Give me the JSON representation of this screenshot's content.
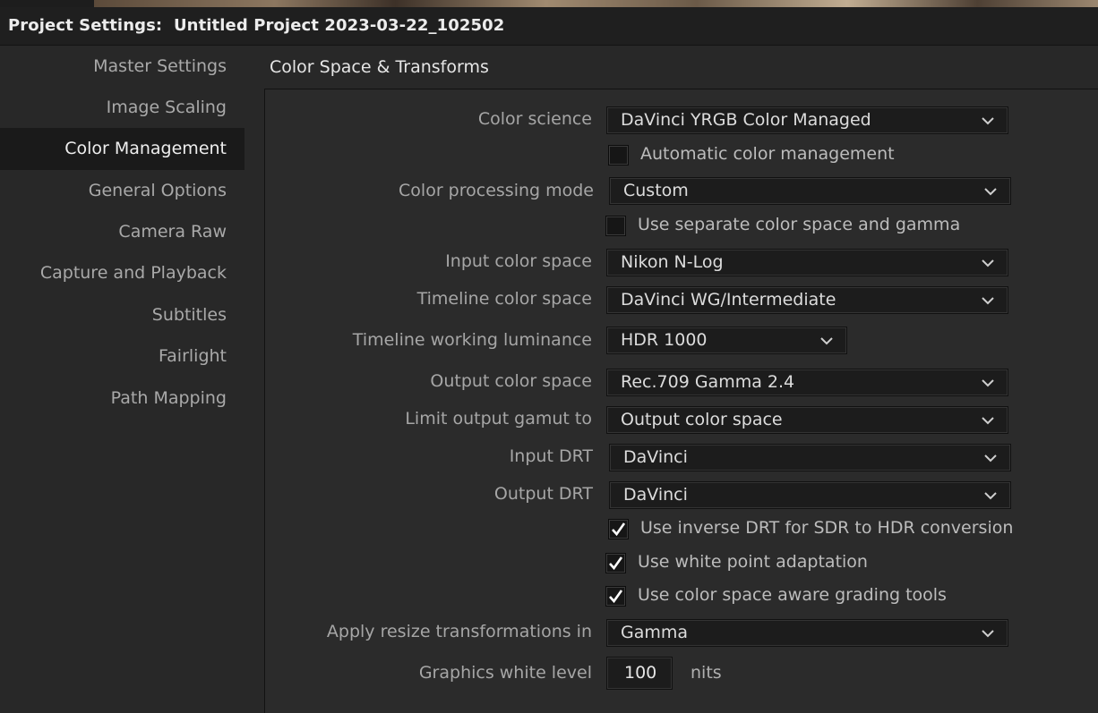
{
  "window": {
    "title": "Project Settings:  Untitled Project 2023-03-22_102502"
  },
  "sidebar": {
    "items": [
      {
        "label": "Master Settings"
      },
      {
        "label": "Image Scaling"
      },
      {
        "label": "Color Management",
        "active": true
      },
      {
        "label": "General Options"
      },
      {
        "label": "Camera Raw"
      },
      {
        "label": "Capture and Playback"
      },
      {
        "label": "Subtitles"
      },
      {
        "label": "Fairlight"
      },
      {
        "label": "Path Mapping"
      }
    ]
  },
  "section": {
    "title": "Color Space & Transforms"
  },
  "fields": {
    "color_science": {
      "label": "Color science",
      "value": "DaVinci YRGB Color Managed"
    },
    "auto_color_mgmt": {
      "label": "Automatic color management",
      "checked": false
    },
    "color_processing_mode": {
      "label": "Color processing mode",
      "value": "Custom"
    },
    "separate_space_gamma": {
      "label": "Use separate color space and gamma",
      "checked": false
    },
    "input_color_space": {
      "label": "Input color space",
      "value": "Nikon N-Log"
    },
    "timeline_color_space": {
      "label": "Timeline color space",
      "value": "DaVinci WG/Intermediate"
    },
    "timeline_working_luminance": {
      "label": "Timeline working luminance",
      "value": "HDR 1000"
    },
    "output_color_space": {
      "label": "Output color space",
      "value": "Rec.709 Gamma 2.4"
    },
    "limit_output_gamut": {
      "label": "Limit output gamut to",
      "value": "Output color space"
    },
    "input_drt": {
      "label": "Input DRT",
      "value": "DaVinci"
    },
    "output_drt": {
      "label": "Output DRT",
      "value": "DaVinci"
    },
    "inverse_drt": {
      "label": "Use inverse DRT for SDR to HDR conversion",
      "checked": true
    },
    "white_point_adaptation": {
      "label": "Use white point adaptation",
      "checked": true
    },
    "space_aware_grading": {
      "label": "Use color space aware grading tools",
      "checked": true
    },
    "resize_transform": {
      "label": "Apply resize transformations in",
      "value": "Gamma"
    },
    "graphics_white_level": {
      "label": "Graphics white level",
      "value": "100",
      "unit": "nits"
    }
  },
  "icons": {
    "dropdown": "chevron-down-icon",
    "checkbox_checked": "checkmark-icon"
  },
  "colors": {
    "background": "#282828",
    "titlebar": "#1f1f1f",
    "field": "#1c1c1c",
    "text": "#a6a6a6"
  }
}
